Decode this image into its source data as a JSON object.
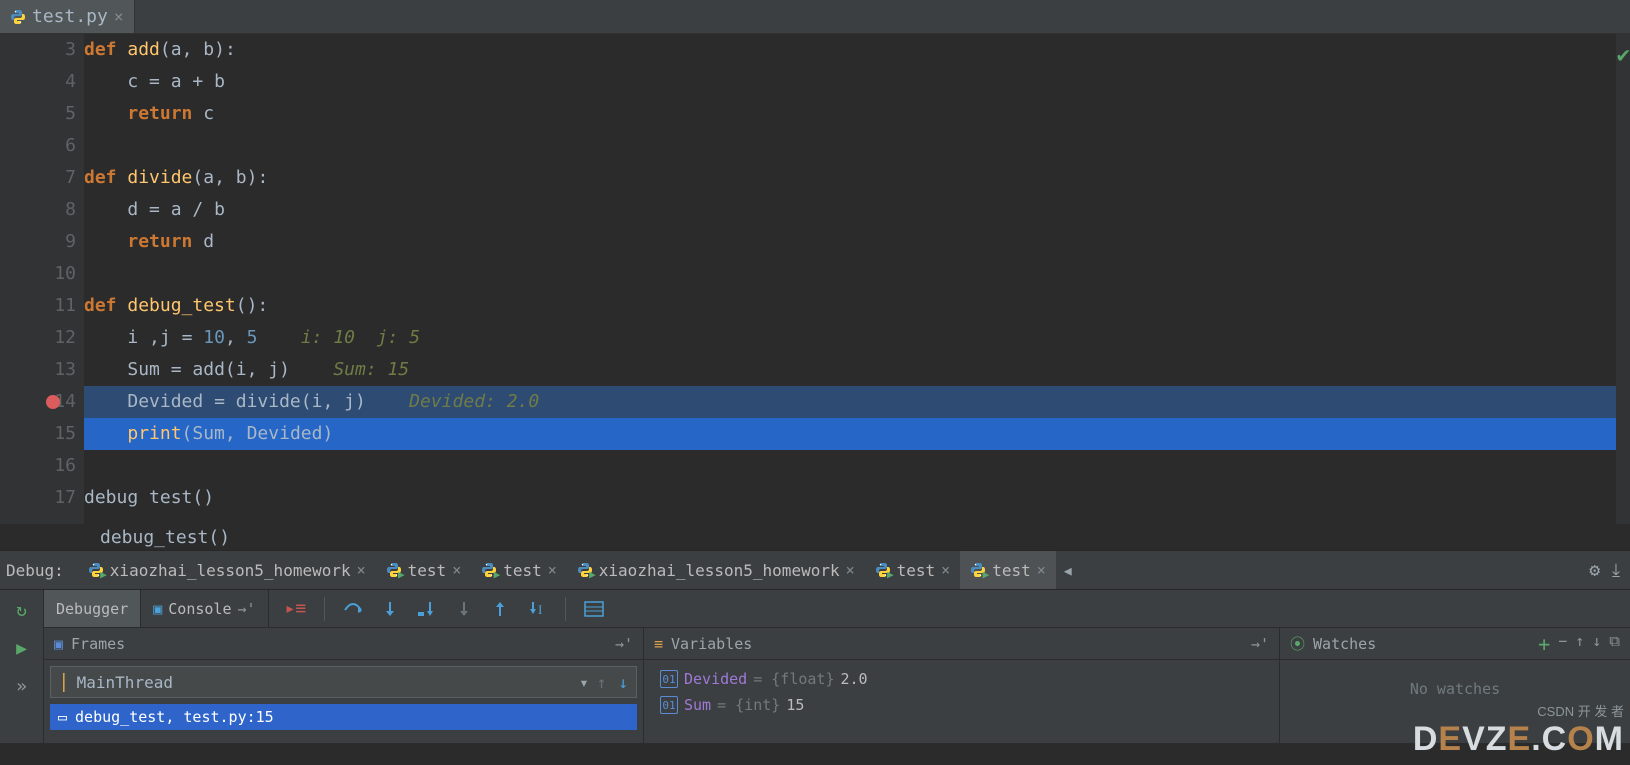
{
  "file_tab": {
    "name": "test.py"
  },
  "gutter_lines": [
    "3",
    "4",
    "5",
    "6",
    "7",
    "8",
    "9",
    "10",
    "11",
    "12",
    "13",
    "14",
    "15",
    "16",
    "17"
  ],
  "breakpoint_line_index": 11,
  "highlight_dark_index": 11,
  "highlight_bright_index": 12,
  "code_lines": [
    {
      "indent": 0,
      "tokens": [
        [
          "k-def",
          "def "
        ],
        [
          "k-fn",
          "add"
        ],
        [
          "k-par",
          "(a"
        ],
        [
          "k-op",
          ", "
        ],
        [
          "k-par",
          "b)"
        ],
        [
          "k-op",
          ":"
        ]
      ]
    },
    {
      "indent": 1,
      "tokens": [
        [
          "k-id",
          "c "
        ],
        [
          "k-op",
          "= "
        ],
        [
          "k-id",
          "a "
        ],
        [
          "k-op",
          "+ "
        ],
        [
          "k-id",
          "b"
        ]
      ]
    },
    {
      "indent": 1,
      "tokens": [
        [
          "k-kw",
          "return "
        ],
        [
          "k-id",
          "c"
        ]
      ]
    },
    {
      "indent": 0,
      "tokens": []
    },
    {
      "indent": 0,
      "tokens": [
        [
          "k-def",
          "def "
        ],
        [
          "k-fn",
          "divide"
        ],
        [
          "k-par",
          "(a"
        ],
        [
          "k-op",
          ", "
        ],
        [
          "k-par",
          "b)"
        ],
        [
          "k-op",
          ":"
        ]
      ]
    },
    {
      "indent": 1,
      "tokens": [
        [
          "k-id",
          "d "
        ],
        [
          "k-op",
          "= "
        ],
        [
          "k-id",
          "a "
        ],
        [
          "k-op",
          "/ "
        ],
        [
          "k-id",
          "b"
        ]
      ]
    },
    {
      "indent": 1,
      "tokens": [
        [
          "k-kw",
          "return "
        ],
        [
          "k-id",
          "d"
        ]
      ]
    },
    {
      "indent": 0,
      "tokens": []
    },
    {
      "indent": 0,
      "tokens": [
        [
          "k-def",
          "def "
        ],
        [
          "k-fn",
          "debug_test"
        ],
        [
          "k-par",
          "()"
        ],
        [
          "k-op",
          ":"
        ]
      ]
    },
    {
      "indent": 1,
      "tokens": [
        [
          "k-id",
          "i "
        ],
        [
          "k-op",
          ","
        ],
        [
          "k-id",
          "j "
        ],
        [
          "k-op",
          "= "
        ],
        [
          "k-num",
          "10"
        ],
        [
          "k-op",
          ", "
        ],
        [
          "k-num",
          "5"
        ]
      ],
      "inline": "  i: 10  j: 5"
    },
    {
      "indent": 1,
      "tokens": [
        [
          "k-id",
          "Sum "
        ],
        [
          "k-op",
          "= "
        ],
        [
          "k-id",
          "add(i"
        ],
        [
          "k-op",
          ", "
        ],
        [
          "k-id",
          "j)"
        ]
      ],
      "inline": "  Sum: 15"
    },
    {
      "indent": 1,
      "tokens": [
        [
          "k-id",
          "Devided "
        ],
        [
          "k-op",
          "= "
        ],
        [
          "k-id",
          "divide(i"
        ],
        [
          "k-op",
          ", "
        ],
        [
          "k-id",
          "j)"
        ]
      ],
      "inline": "  Devided: 2.0"
    },
    {
      "indent": 1,
      "tokens": [
        [
          "k-fn",
          "print"
        ],
        [
          "k-id",
          "(Sum"
        ],
        [
          "k-op",
          ", "
        ],
        [
          "k-id",
          "Devided)"
        ]
      ]
    },
    {
      "indent": 0,
      "tokens": []
    },
    {
      "indent": 0,
      "tokens": [
        [
          "k-id",
          "debug test()"
        ]
      ]
    }
  ],
  "exec_line": "debug_test()",
  "debug_label": "Debug:",
  "debug_tabs": [
    {
      "label": "xiaozhai_lesson5_homework",
      "active": false
    },
    {
      "label": "test",
      "active": false
    },
    {
      "label": "test",
      "active": false
    },
    {
      "label": "xiaozhai_lesson5_homework",
      "active": false
    },
    {
      "label": "test",
      "active": false
    },
    {
      "label": "test",
      "active": true
    }
  ],
  "subtabs": {
    "debugger": "Debugger",
    "console": "Console"
  },
  "panels": {
    "frames_title": "Frames",
    "vars_title": "Variables",
    "watches_title": "Watches",
    "no_watches": "No watches"
  },
  "thread_selected": "MainThread",
  "stack_frame": "debug_test, test.py:15",
  "variables": [
    {
      "name": "Devided",
      "type": "{float}",
      "value": "2.0"
    },
    {
      "name": "Sum",
      "type": "{int}",
      "value": "15"
    }
  ],
  "watermark": {
    "brand": "DevZe.CoM",
    "tag": "开 发 者",
    "csdn": "CSDN"
  }
}
